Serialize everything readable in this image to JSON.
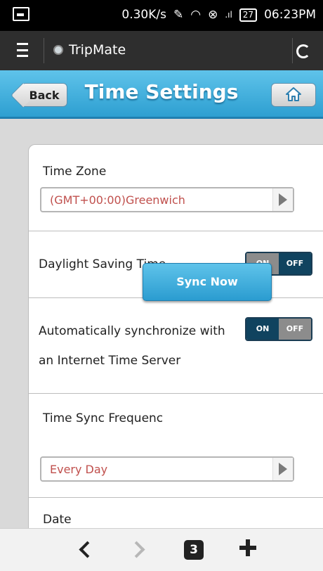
{
  "status_bar": {
    "network_speed": "0.30K/s",
    "battery": "27",
    "time": "06:23PM"
  },
  "app_bar": {
    "title": "TripMate"
  },
  "header": {
    "back_label": "Back",
    "title": "Time Settings"
  },
  "settings": {
    "time_zone": {
      "label": "Time Zone",
      "value": "(GMT+00:00)Greenwich"
    },
    "daylight_saving": {
      "label": "Daylight Saving Time",
      "on_label": "ON",
      "off_label": "OFF",
      "state": "OFF"
    },
    "auto_sync": {
      "label_line1": "Automatically synchronize with",
      "label_line2": "an Internet Time Server",
      "on_label": "ON",
      "off_label": "OFF",
      "state": "ON"
    },
    "sync_frequency": {
      "label": "Time Sync Frequenc",
      "value": "Every Day",
      "sync_now_label": "Sync Now"
    },
    "date": {
      "label": "Date"
    }
  },
  "bottom_bar": {
    "tab_count": "3"
  }
}
